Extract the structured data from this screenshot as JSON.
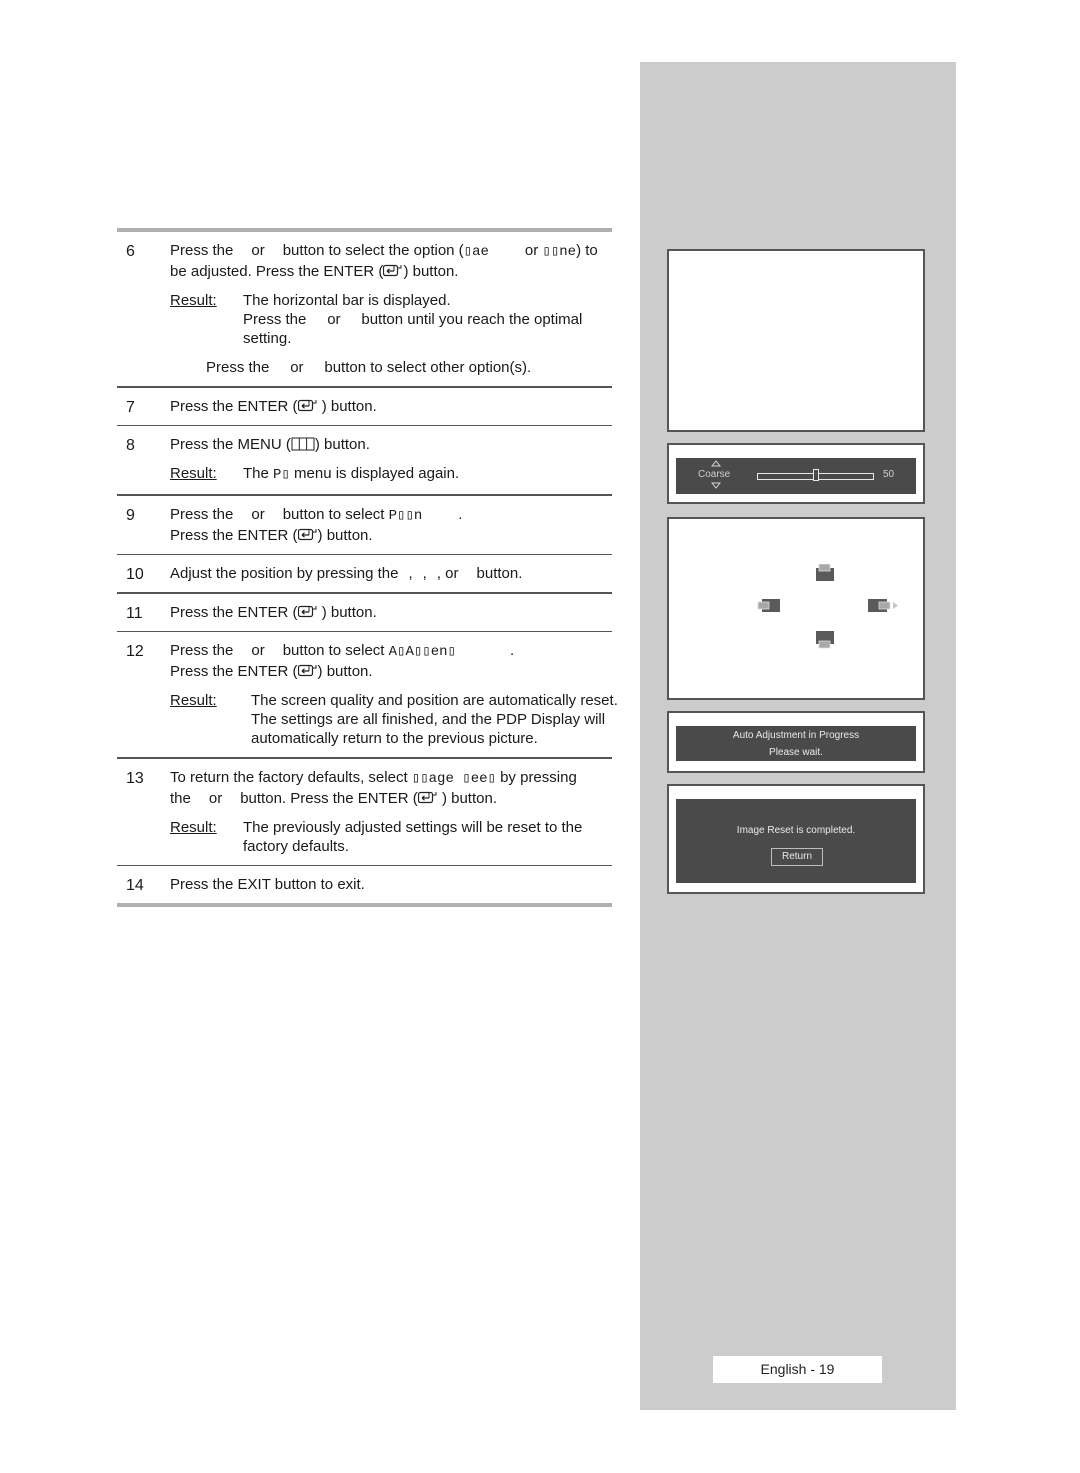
{
  "steps": [
    {
      "number": "6",
      "lines": [
        "Press the",
        "or",
        "button to select the option (",
        "ᐩæ",
        "or",
        "ᐩᐩne) to"
      ],
      "line1": {
        "a": "Press the",
        "b": "or",
        "c": "button to select the option (",
        "g1": "▯ae",
        "d": "or",
        "g2": "▯▯ne",
        "e": ") to"
      },
      "line2": {
        "a": "be adjusted. Press the ENTER (",
        "b": ") button."
      },
      "result_label": "Result",
      "result_lines": [
        "The horizontal bar is displayed.",
        "Press the     or     button until you reach the optimal",
        "setting."
      ],
      "note": "Press the     or     button to select other option(s)."
    },
    {
      "number": "7",
      "line1": {
        "a": "Press the ENTER (",
        "b": " ) button."
      }
    },
    {
      "number": "8",
      "line1": {
        "a": "Press the MENU (",
        "b": ") button."
      },
      "result_label": "Result",
      "result": {
        "a": "The ",
        "g": "P▯",
        "b": " menu is displayed again."
      }
    },
    {
      "number": "9",
      "line1": {
        "a": "Press the",
        "b": "or",
        "c": "button to select ",
        "g": "P▯▯n",
        "d": "."
      },
      "line2": {
        "a": "Press the ENTER (",
        "b": ") button."
      }
    },
    {
      "number": "10",
      "line1": {
        "a": "Adjust the position by pressing the",
        "b": ",",
        "c": ",",
        "d": ", or",
        "e": "button."
      }
    },
    {
      "number": "11",
      "line1": {
        "a": "Press the ENTER (",
        "b": " ) button."
      }
    },
    {
      "number": "12",
      "line1": {
        "a": "Press the",
        "b": "or",
        "c": "button to select ",
        "g": "A▯A▯▯en▯",
        "d": "."
      },
      "line2": {
        "a": "Press the ENTER (",
        "b": ") button."
      },
      "result_label": "Result",
      "result_lines": [
        "The screen quality and position are automatically reset.",
        "The settings are all finished, and the PDP Display will",
        "automatically return to the previous picture."
      ]
    },
    {
      "number": "13",
      "line1": {
        "a": "To return the factory defaults, select ",
        "g": "▯▯age ▯ee▯",
        "b": " by pressing"
      },
      "line2": {
        "a": "the",
        "b": "or",
        "c": "button. Press the ENTER (",
        "d": " ) button."
      },
      "result_label": "Result",
      "result_lines": [
        "The previously adjusted settings will be reset to the",
        "factory defaults."
      ]
    },
    {
      "number": "14",
      "line1": {
        "a": "Press the EXIT button to exit."
      }
    }
  ],
  "osd": {
    "coarse": {
      "label": "Coarse",
      "value": "50",
      "level_percent": 50
    },
    "auto_adjust": {
      "line1": "Auto Adjustment in Progress",
      "line2": "Please wait."
    },
    "image_reset": {
      "message": "Image Reset is completed.",
      "button": "Return"
    }
  },
  "footer": {
    "page_label": "English - 19"
  },
  "icons": {
    "enter": "enter-icon",
    "menu": "menu-icon",
    "up": "up-triangle-icon",
    "down": "down-triangle-icon"
  }
}
